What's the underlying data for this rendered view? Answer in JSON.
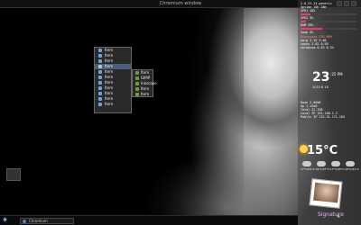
{
  "window": {
    "title": "Chromium window",
    "app": "Chromium"
  },
  "menu": {
    "items": [
      {
        "label": "Item",
        "color": "#6fa0d8"
      },
      {
        "label": "Item",
        "color": "#6fa0d8"
      },
      {
        "label": "Item",
        "color": "#6fa0d8"
      },
      {
        "label": "Item",
        "color": "#c1c1c1",
        "selected": true
      },
      {
        "label": "Item",
        "color": "#6fa0d8"
      },
      {
        "label": "Item",
        "color": "#6fa0d8"
      },
      {
        "label": "Item",
        "color": "#6fa0d8"
      },
      {
        "label": "Item",
        "color": "#6fa0d8"
      },
      {
        "label": "Item",
        "color": "#6fa0d8"
      },
      {
        "label": "Item",
        "color": "#6fa0d8"
      },
      {
        "label": "Item",
        "color": "#6fa0d8"
      }
    ]
  },
  "submenu": {
    "items": [
      "Item",
      "GIMP",
      "Inkscape",
      "Item",
      "Item"
    ]
  },
  "taskbar": {
    "task_label": "Chromium"
  },
  "conky": {
    "header": "2.6.31-14-generic",
    "uptime": "Uptime 10h 28m",
    "cpu1": "CPU1 18%",
    "cpu2": "CPU2 9%",
    "ram": "RAM 39%",
    "swap": "Swap 0%",
    "proc_header": "Processes CPU MEM",
    "proc1": "xorg 2.15 3.06",
    "proc2": "conky 1.02 0.95",
    "proc3": "chromium 0.45 6.34"
  },
  "clock": {
    "time": "23",
    "minutes": ":25",
    "ampm": "PM",
    "date": "2010 8 18"
  },
  "net": {
    "down": "Down 2.00kB",
    "up": "Up 1.12kB",
    "total_down": "Total 22.7GB",
    "local_ip": "Local IP 192.168.1.2",
    "public_ip": "Public IP 122.31.171.165"
  },
  "weather": {
    "temp": "15°C",
    "days": [
      {
        "label": "17°C/22°C"
      },
      {
        "label": "19°C/27°C"
      },
      {
        "label": "17°C/25°C"
      },
      {
        "label": "16°C/22°C"
      }
    ]
  },
  "signature": "Signature"
}
